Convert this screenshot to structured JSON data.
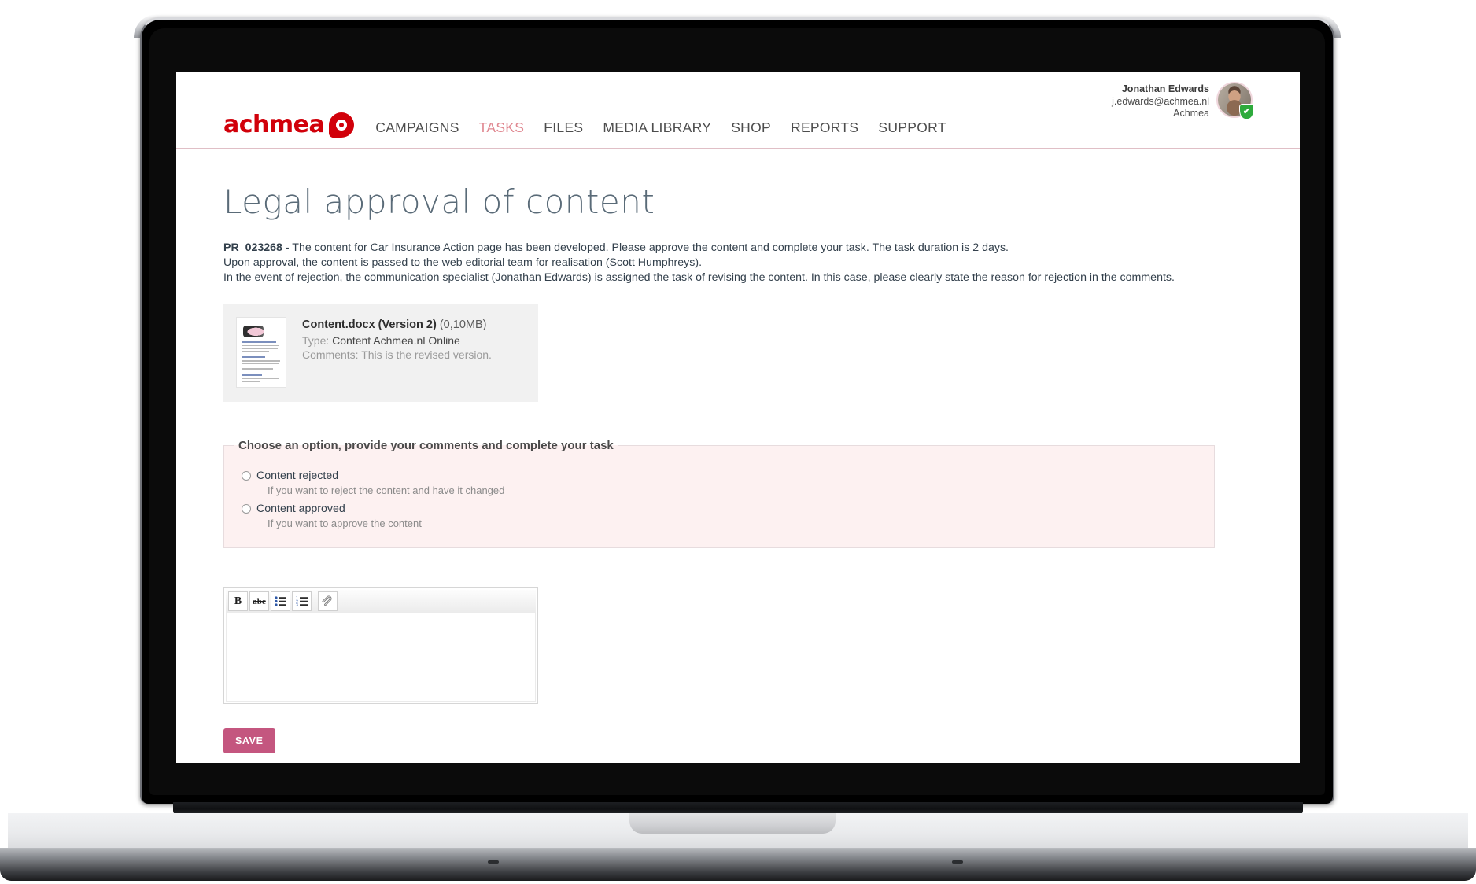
{
  "header": {
    "brand": {
      "wordmark": "achmea",
      "mark_icon": "achmea-logo-mark"
    },
    "nav": [
      {
        "label": "CAMPAIGNS",
        "active": false
      },
      {
        "label": "TASKS",
        "active": true
      },
      {
        "label": "FILES",
        "active": false
      },
      {
        "label": "MEDIA LIBRARY",
        "active": false
      },
      {
        "label": "SHOP",
        "active": false
      },
      {
        "label": "REPORTS",
        "active": false
      },
      {
        "label": "SUPPORT",
        "active": false
      }
    ],
    "user": {
      "name": "Jonathan Edwards",
      "email": "j.edwards@achmea.nl",
      "organisation": "Achmea",
      "verified_icon": "✔",
      "verified_color": "#2eaa3c"
    }
  },
  "main": {
    "title": "Legal approval of content",
    "description": {
      "reference": "PR_023268",
      "line1_rest": " - The content for Car Insurance Action page has been developed. Please approve the content and complete your task. The task duration is 2 days.",
      "line2": "Upon approval, the content is passed to the web editorial team for realisation (Scott Humphreys).",
      "line3": "In the event of rejection, the communication specialist (Jonathan Edwards) is assigned the task of revising the content. In this case, please clearly state the reason for rejection in the comments."
    },
    "file_card": {
      "thumbnail_icon": "document-thumbnail",
      "name": "Content.docx (Version 2)",
      "size": "(0,10MB)",
      "type_label": "Type:",
      "type_value": "Content Achmea.nl Online",
      "comments_label": "Comments:",
      "comments_value": "This is the revised version."
    },
    "option_panel": {
      "legend": "Choose an option, provide your comments and complete your task",
      "background_color": "#fdf1f1",
      "options": [
        {
          "label": "Content rejected",
          "hint": "If you want to reject the content and have it changed",
          "selected": false
        },
        {
          "label": "Content approved",
          "hint": "If you want to approve the content",
          "selected": false
        }
      ]
    },
    "editor": {
      "toolbar": [
        {
          "icon": "bold-icon",
          "glyph": "B"
        },
        {
          "icon": "strikethrough-icon",
          "glyph": "abc"
        },
        {
          "icon": "bullet-list-icon",
          "glyph": ""
        },
        {
          "icon": "numbered-list-icon",
          "glyph": ""
        },
        {
          "icon": "paperclip-attach-icon",
          "glyph": ""
        }
      ],
      "value": "",
      "placeholder": ""
    },
    "save_button": {
      "label": "SAVE",
      "color": "#c4567f"
    }
  }
}
